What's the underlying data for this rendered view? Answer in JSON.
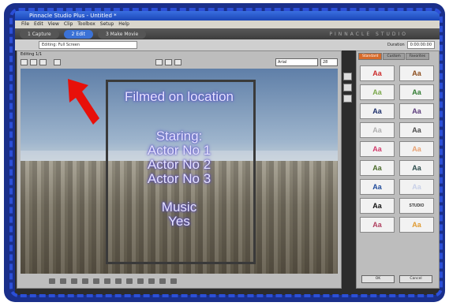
{
  "window": {
    "title": "Pinnacle Studio Plus - Untitled *",
    "menu": [
      "File",
      "Edit",
      "View",
      "Clip",
      "Toolbox",
      "Setup",
      "Help"
    ]
  },
  "modes": [
    "1 Capture",
    "2 Edit",
    "3 Make Movie"
  ],
  "brand": "PINNACLE STUDIO",
  "title_field": "Editing: Full Screen",
  "duration": {
    "label": "Duration",
    "value": "0:00:00:00"
  },
  "editor_label": "Editing 1/1",
  "font_select": "Arial",
  "size_select": "28",
  "credits": {
    "line1": "Filmed on location",
    "line2": "Staring:",
    "line3": "Actor No 1",
    "line4": "Actor No 2",
    "line5": "Actor No 3",
    "line6": "Music",
    "line7": "Yes"
  },
  "style_tabs": [
    "Standard",
    "Custom",
    "Favorites"
  ],
  "style_swatches": [
    {
      "label": "Aa",
      "color": "#cc2a2a"
    },
    {
      "label": "Aa",
      "color": "#8a4a1a"
    },
    {
      "label": "Aa",
      "color": "#7aa84a"
    },
    {
      "label": "Aa",
      "color": "#2f7a2f"
    },
    {
      "label": "Aa",
      "color": "#1d2f6b"
    },
    {
      "label": "Aa",
      "color": "#5a3a7a"
    },
    {
      "label": "Aa",
      "color": "#b0b0b0"
    },
    {
      "label": "Aa",
      "color": "#4a4a4a"
    },
    {
      "label": "Aa",
      "color": "#d23a6a"
    },
    {
      "label": "Aa",
      "color": "#e8a070"
    },
    {
      "label": "Aa",
      "color": "#4a6a2a"
    },
    {
      "label": "Aa",
      "color": "#2a4a4a"
    },
    {
      "label": "Aa",
      "color": "#1e4a9a"
    },
    {
      "label": "Aa",
      "color": "#c8d0e8"
    },
    {
      "label": "Aa",
      "color": "#111111"
    },
    {
      "label": "STUDIO",
      "color": "#333333"
    },
    {
      "label": "Aa",
      "color": "#b04060"
    },
    {
      "label": "Aa",
      "color": "#e09a30"
    }
  ],
  "buttons": {
    "ok": "OK",
    "cancel": "Cancel"
  },
  "colors": {
    "frame": "#1a2f8a",
    "dash": "#2b4fd8",
    "arrow": "#e8100a",
    "active_tab": "#3b72d6"
  }
}
